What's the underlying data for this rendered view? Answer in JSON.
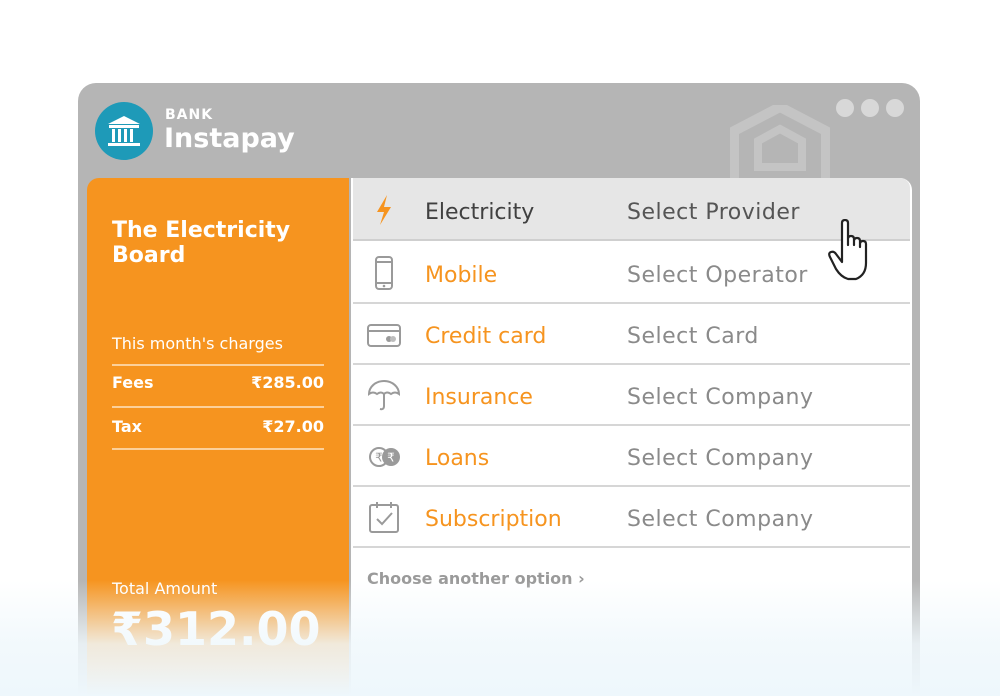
{
  "app": {
    "brand_small": "BANK",
    "brand_name": "Instapay"
  },
  "summary": {
    "title": "The Electricity Board",
    "charges_label": "This month's charges",
    "charges": [
      {
        "label": "Fees",
        "value": "₹285.00"
      },
      {
        "label": "Tax",
        "value": "₹27.00"
      }
    ],
    "total_label": "Total Amount",
    "total_value": "₹312.00"
  },
  "options": [
    {
      "name": "Electricity",
      "select": "Select Provider",
      "icon": "lightning-bolt-icon",
      "active": true
    },
    {
      "name": "Mobile",
      "select": "Select Operator",
      "icon": "mobile-phone-icon",
      "active": false
    },
    {
      "name": "Credit card",
      "select": "Select Card",
      "icon": "credit-card-icon",
      "active": false
    },
    {
      "name": "Insurance",
      "select": "Select Company",
      "icon": "umbrella-icon",
      "active": false
    },
    {
      "name": "Loans",
      "select": "Select Company",
      "icon": "coins-icon",
      "active": false
    },
    {
      "name": "Subscription",
      "select": "Select Company",
      "icon": "calendar-check-icon",
      "active": false
    }
  ],
  "another_option": "Choose another option",
  "colors": {
    "accent": "#f6941f",
    "window": "#b5b5b5",
    "logo": "#1e9ab8",
    "active_row": "#e6e6e6"
  }
}
